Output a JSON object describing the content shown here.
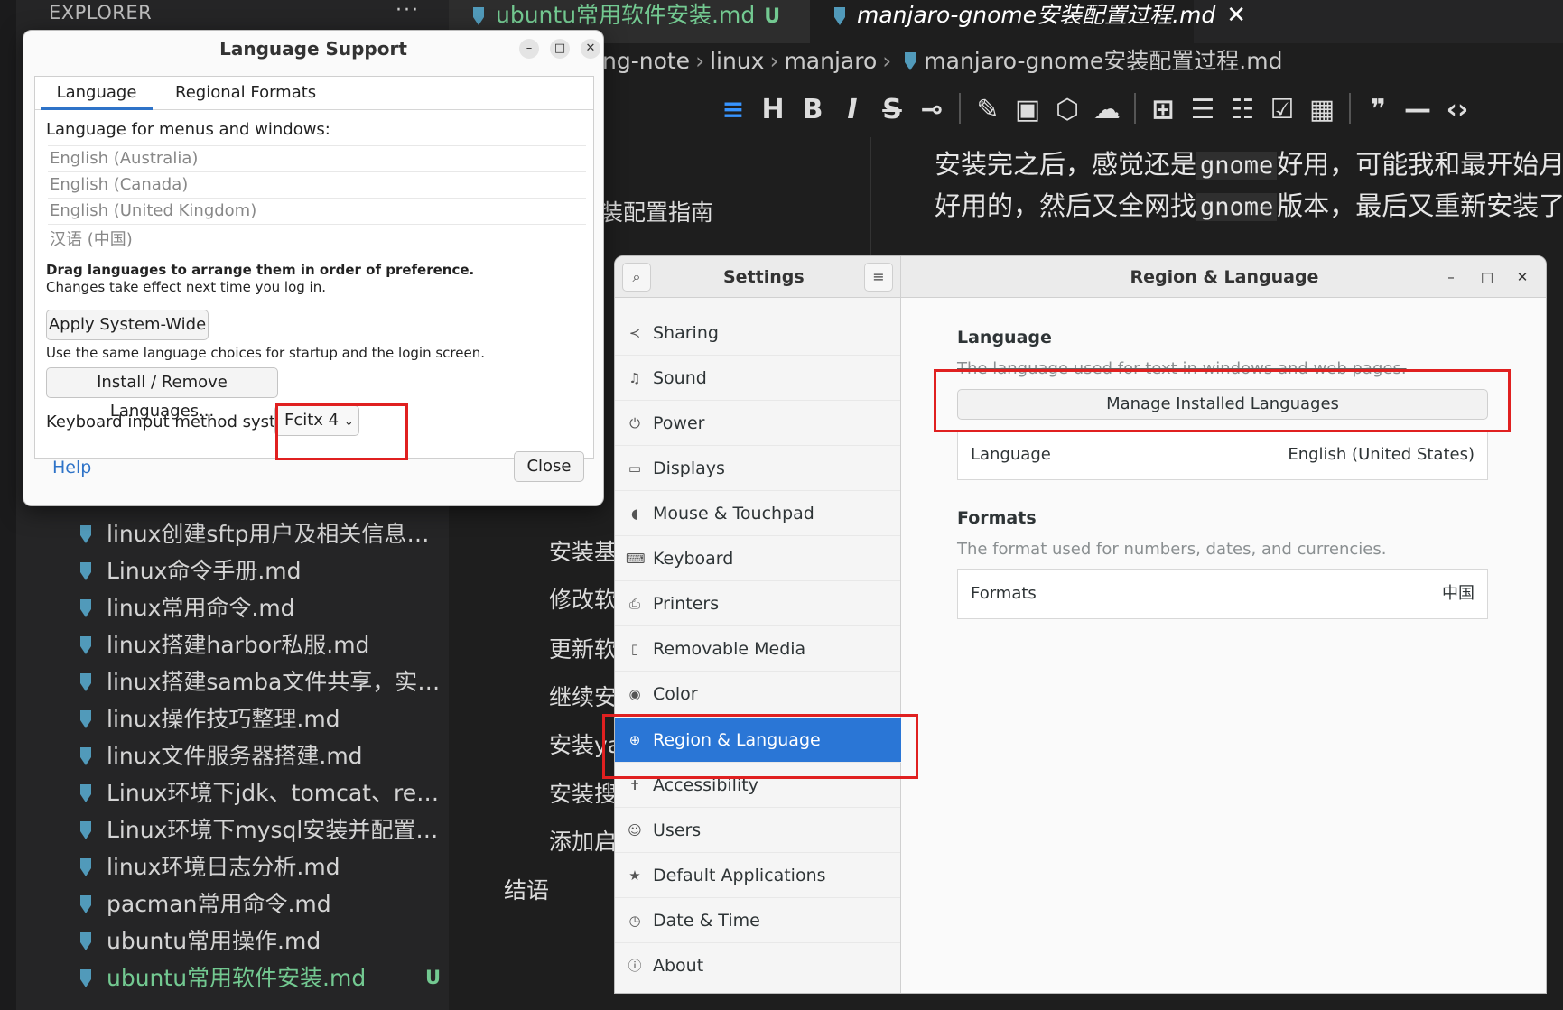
{
  "vscode": {
    "explorer_title": "EXPLORER",
    "explorer_more": "···",
    "files": [
      {
        "name": "linux创建sftp用户及相关信息配...",
        "status": ""
      },
      {
        "name": "Linux命令手册.md",
        "status": ""
      },
      {
        "name": "linux常用命令.md",
        "status": ""
      },
      {
        "name": "linux搭建harbor私服.md",
        "status": ""
      },
      {
        "name": "linux搭建samba文件共享，实现...",
        "status": ""
      },
      {
        "name": "linux操作技巧整理.md",
        "status": ""
      },
      {
        "name": "linux文件服务器搭建.md",
        "status": ""
      },
      {
        "name": "Linux环境下jdk、tomcat、redis...",
        "status": ""
      },
      {
        "name": "Linux环境下mysql安装并配置远...",
        "status": ""
      },
      {
        "name": "linux环境日志分析.md",
        "status": ""
      },
      {
        "name": "pacman常用命令.md",
        "status": ""
      },
      {
        "name": "ubuntu常用操作.md",
        "status": ""
      },
      {
        "name": "ubuntu常用软件安装.md",
        "status": "U"
      }
    ],
    "tabs": [
      {
        "label": "ubuntu常用软件安装.md",
        "status": "U"
      },
      {
        "label": "manjaro-gnome安装配置过程.md",
        "close": "✕"
      }
    ],
    "breadcrumb": [
      "ng-note",
      "linux",
      "manjaro",
      "manjaro-gnome安装配置过程.md"
    ],
    "toolbar": [
      "≡",
      "H",
      "B",
      "I",
      "S",
      "⊸",
      "✎",
      "▣",
      "⬡",
      "☁",
      "⊞",
      "☰",
      "☷",
      "☑",
      "▦",
      "❞",
      "—",
      "‹›"
    ],
    "outline": [
      "装配置指南",
      "安装基",
      "修改软",
      "更新软",
      "继续安",
      "安装ya",
      "安装搜",
      "添加启",
      "结语"
    ],
    "editor_line1_a": "安装完之后，感觉还是",
    "editor_line1_code": "gnome",
    "editor_line1_b": "好用，可能我和最开始月",
    "editor_line2_a": "好用的，然后又全网找",
    "editor_line2_code": "gnome",
    "editor_line2_b": "版本，最后又重新安装了"
  },
  "language_support": {
    "title": "Language Support",
    "tabs": [
      "Language",
      "Regional Formats"
    ],
    "menus_label": "Language for menus and windows:",
    "languages": [
      "English (Australia)",
      "English (Canada)",
      "English (United Kingdom)",
      "汉语 (中国)"
    ],
    "drag_hint": "Drag languages to arrange them in order of preference.",
    "changes_hint": "Changes take effect next time you log in.",
    "apply_button": "Apply System-Wide",
    "same_choice_hint": "Use the same language choices for startup and the login screen.",
    "install_button": "Install / Remove Languages...",
    "keyboard_label": "Keyboard input method system:",
    "keyboard_value": "Fcitx 4",
    "help": "Help",
    "close": "Close"
  },
  "settings": {
    "sidebar_title": "Settings",
    "panel_title": "Region & Language",
    "sidebar_items": [
      {
        "label": "Sharing",
        "icon": "share-icon",
        "glyph": "≺"
      },
      {
        "label": "Sound",
        "icon": "music-note-icon",
        "glyph": "♫"
      },
      {
        "label": "Power",
        "icon": "power-icon",
        "glyph": "⏻"
      },
      {
        "label": "Displays",
        "icon": "display-icon",
        "glyph": "▭"
      },
      {
        "label": "Mouse & Touchpad",
        "icon": "mouse-icon",
        "glyph": "◖"
      },
      {
        "label": "Keyboard",
        "icon": "keyboard-icon",
        "glyph": "⌨"
      },
      {
        "label": "Printers",
        "icon": "printer-icon",
        "glyph": "⎙"
      },
      {
        "label": "Removable Media",
        "icon": "usb-icon",
        "glyph": "▯"
      },
      {
        "label": "Color",
        "icon": "color-icon",
        "glyph": "◉"
      },
      {
        "label": "Region & Language",
        "icon": "globe-icon",
        "glyph": "⊕"
      },
      {
        "label": "Accessibility",
        "icon": "accessibility-icon",
        "glyph": "✝"
      },
      {
        "label": "Users",
        "icon": "users-icon",
        "glyph": "☺"
      },
      {
        "label": "Default Applications",
        "icon": "star-icon",
        "glyph": "★"
      },
      {
        "label": "Date & Time",
        "icon": "clock-icon",
        "glyph": "◷"
      },
      {
        "label": "About",
        "icon": "info-icon",
        "glyph": "ⓘ"
      }
    ],
    "selected": "Region & Language",
    "language_section": "Language",
    "language_sub": "The language used for text in windows and web pages.",
    "manage_button": "Manage Installed Languages",
    "language_row_label": "Language",
    "language_row_value": "English (United States)",
    "formats_section": "Formats",
    "formats_sub": "The format used for numbers, dates, and currencies.",
    "formats_row_label": "Formats",
    "formats_row_value": "中国"
  },
  "colors": {
    "highlight": "#e02020",
    "selection": "#2a76d6",
    "untracked": "#73c991"
  }
}
